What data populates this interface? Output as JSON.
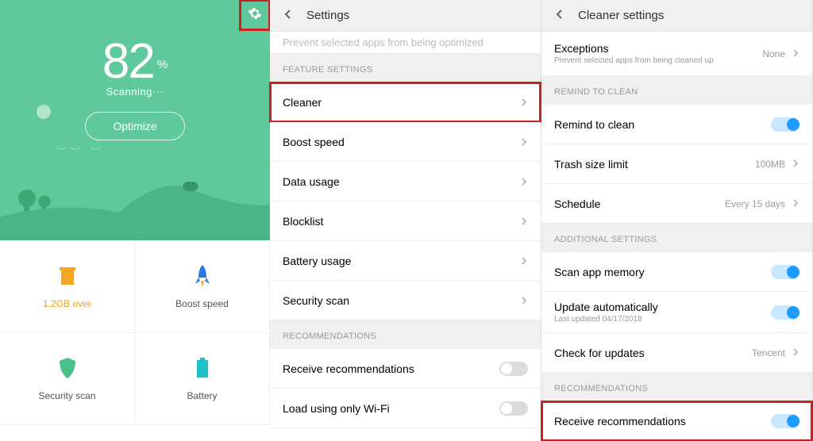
{
  "panel1": {
    "score": "82",
    "percent": "%",
    "status": "Scanning···",
    "optimize": "Optimize",
    "tiles": {
      "trash": "1.2GB over",
      "boost": "Boost speed",
      "security": "Security scan",
      "battery": "Battery"
    }
  },
  "panel2": {
    "title": "Settings",
    "faded_line": "Prevent selected apps from being optimized",
    "section_feature": "FEATURE SETTINGS",
    "items": {
      "cleaner": "Cleaner",
      "boost": "Boost speed",
      "data": "Data usage",
      "block": "Blocklist",
      "battery": "Battery usage",
      "security": "Security scan"
    },
    "section_reco": "RECOMMENDATIONS",
    "reco1": "Receive recommendations",
    "reco2": "Load using only Wi-Fi"
  },
  "panel3": {
    "title": "Cleaner settings",
    "exceptions": "Exceptions",
    "exceptions_sub": "Prevent selected apps from being cleaned up",
    "exceptions_val": "None",
    "section_remind": "REMIND TO CLEAN",
    "remind": "Remind to clean",
    "trash_limit": "Trash size limit",
    "trash_limit_val": "100MB",
    "schedule": "Schedule",
    "schedule_val": "Every 15 days",
    "section_add": "ADDITIONAL SETTINGS",
    "scan_mem": "Scan app memory",
    "update_auto": "Update automatically",
    "update_auto_sub": "Last updated 04/17/2018",
    "check_upd": "Check for updates",
    "check_upd_val": "Tencent",
    "section_reco": "RECOMMENDATIONS",
    "reco": "Receive recommendations"
  }
}
